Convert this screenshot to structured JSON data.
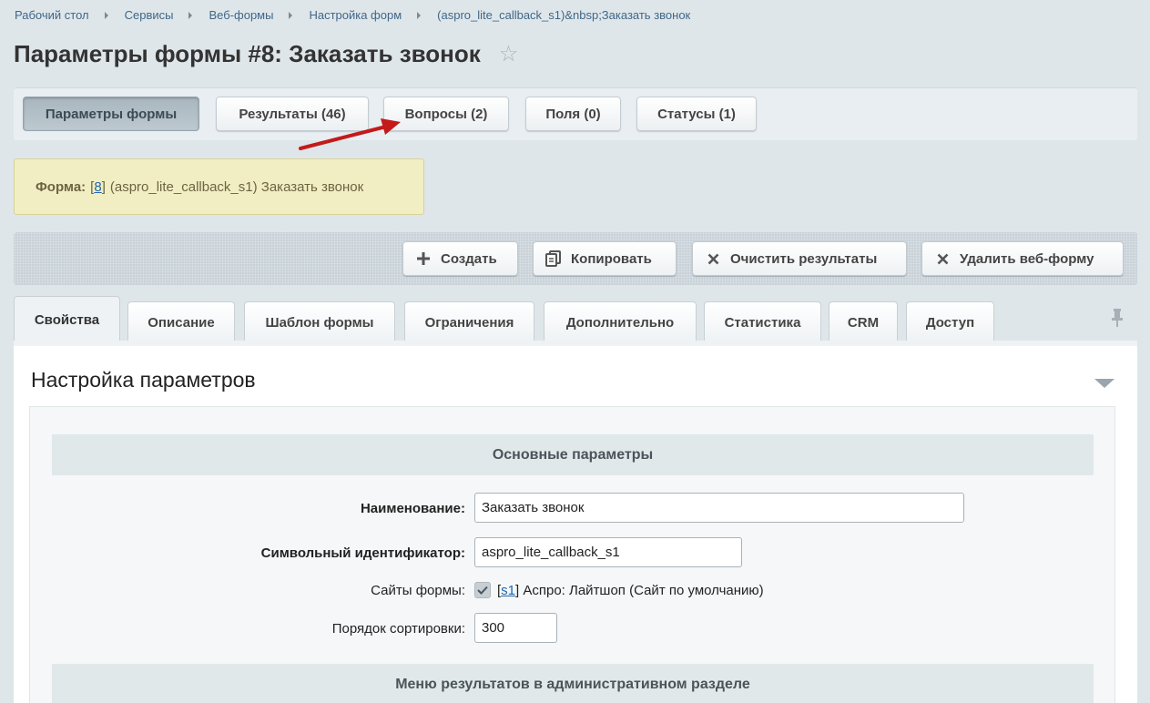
{
  "breadcrumb": [
    "Рабочий стол",
    "Сервисы",
    "Веб-формы",
    "Настройка форм",
    "(aspro_lite_callback_s1)&nbsp;Заказать звонок"
  ],
  "page_title": "Параметры формы #8: Заказать звонок",
  "context_tabs": [
    {
      "label": "Параметры формы",
      "active": true
    },
    {
      "label": "Результаты (46)"
    },
    {
      "label": "Вопросы (2)"
    },
    {
      "label": "Поля (0)"
    },
    {
      "label": "Статусы (1)"
    }
  ],
  "info": {
    "label": "Форма:",
    "bracket_open": "[",
    "id_link": "8",
    "bracket_close": "]",
    "text": "(aspro_lite_callback_s1) Заказать звонок"
  },
  "toolbar": {
    "create": "Создать",
    "copy": "Копировать",
    "clear": "Очистить результаты",
    "delete": "Удалить веб-форму"
  },
  "tabs": [
    "Свойства",
    "Описание",
    "Шаблон формы",
    "Ограничения",
    "Дополнительно",
    "Статистика",
    "CRM",
    "Доступ"
  ],
  "panel": {
    "title": "Настройка параметров",
    "section_main": "Основные параметры",
    "name_label": "Наименование:",
    "name_value": "Заказать звонок",
    "sid_label": "Символьный идентификатор:",
    "sid_value": "aspro_lite_callback_s1",
    "sites_label": "Сайты формы:",
    "site_bracket_open": "[",
    "site_link": "s1",
    "site_text": "] Аспро: Лайтшоп (Сайт по умолчанию)",
    "sort_label": "Порядок сортировки:",
    "sort_value": "300",
    "section_menu": "Меню результатов в административном разделе"
  },
  "colors": {
    "accent_link": "#2067b0",
    "annotation_arrow": "#c41a1a",
    "info_bg": "#f1eec3"
  },
  "icons": [
    "star-icon",
    "plus-icon",
    "copy-icon",
    "close-icon",
    "pin-icon",
    "collapse-icon",
    "checkmark-icon"
  ]
}
